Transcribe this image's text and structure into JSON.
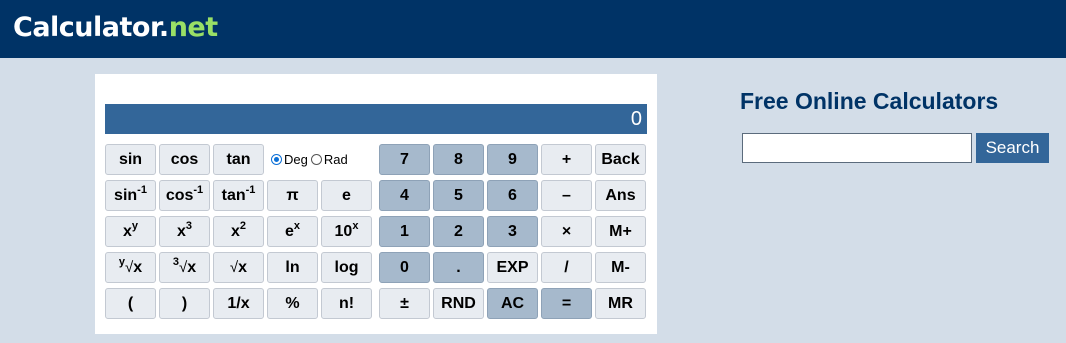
{
  "header": {
    "logo": {
      "word": "Calculator",
      "dot": ".",
      "tld": "net"
    }
  },
  "calculator": {
    "display_value": "0",
    "angle_mode": {
      "options": [
        "Deg",
        "Rad"
      ],
      "selected": "Deg"
    },
    "keys": {
      "sin": "sin",
      "cos": "cos",
      "tan": "tan",
      "asin_base": "sin",
      "acos_base": "cos",
      "atan_base": "tan",
      "inverse_exp": "-1",
      "pi": "π",
      "e": "e",
      "x_base": "x",
      "exp_y": "y",
      "exp_3": "3",
      "exp_2": "2",
      "e_base": "e",
      "ten_base": "10",
      "exp_x": "x",
      "root_y_index": "y",
      "root_3_index": "3",
      "root_sym": "√",
      "root_x": "x",
      "ln": "ln",
      "log": "log",
      "open_paren": "(",
      "close_paren": ")",
      "reciprocal": "1/x",
      "percent": "%",
      "factorial": "n!",
      "d7": "7",
      "d8": "8",
      "d9": "9",
      "plus": "+",
      "back": "Back",
      "d4": "4",
      "d5": "5",
      "d6": "6",
      "minus": "–",
      "ans": "Ans",
      "d1": "1",
      "d2": "2",
      "d3": "3",
      "times": "×",
      "mplus": "M+",
      "d0": "0",
      "decimal": ".",
      "exp": "EXP",
      "divide": "/",
      "mminus": "M-",
      "plus_minus": "±",
      "rnd": "RND",
      "ac": "AC",
      "equals": "=",
      "mr": "MR"
    }
  },
  "sidebar": {
    "title": "Free Online Calculators",
    "search": {
      "value": "",
      "button_label": "Search"
    }
  }
}
